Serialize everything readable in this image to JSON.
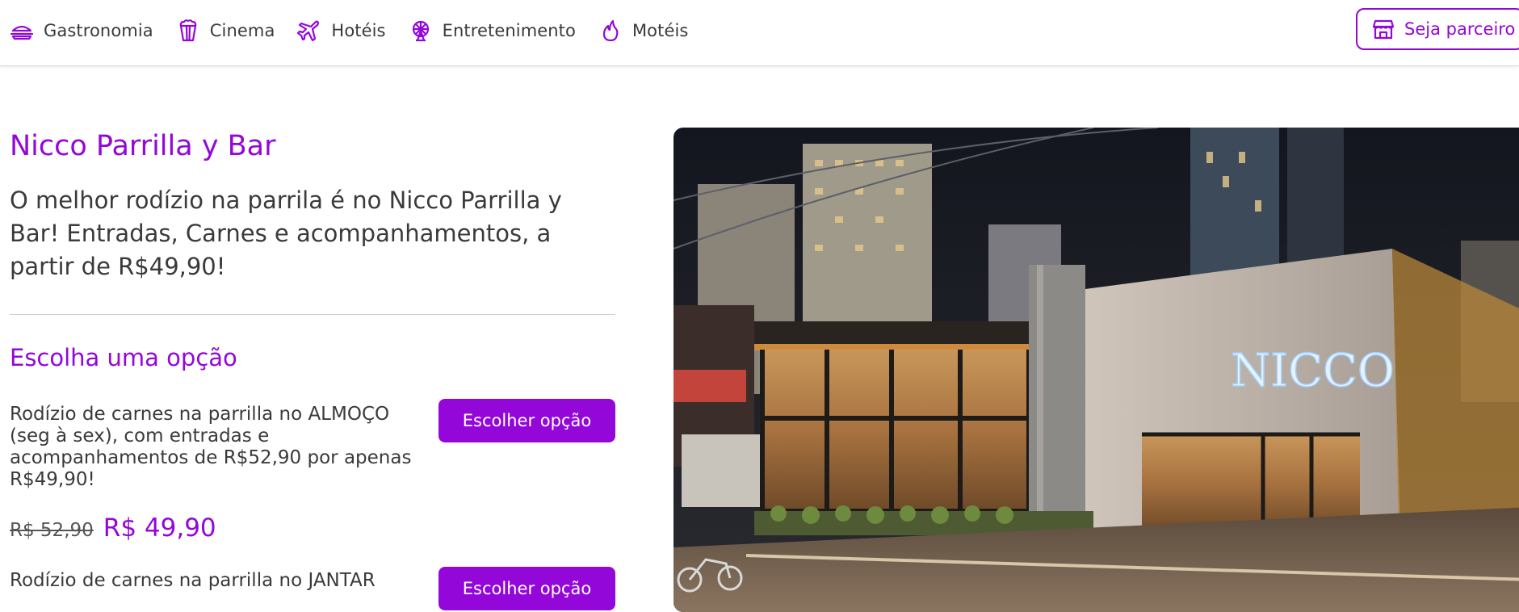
{
  "nav": {
    "items": [
      {
        "label": "Gastronomia",
        "icon": "food-tray-icon"
      },
      {
        "label": "Cinema",
        "icon": "popcorn-icon"
      },
      {
        "label": "Hotéis",
        "icon": "airplane-icon"
      },
      {
        "label": "Entretenimento",
        "icon": "ferris-wheel-icon"
      },
      {
        "label": "Motéis",
        "icon": "flame-icon"
      }
    ],
    "partner_label": "Seja parceiro",
    "partner_icon": "store-icon"
  },
  "colors": {
    "accent": "#9407d9",
    "text": "#3a3a3a"
  },
  "offer": {
    "title": "Nicco Parrilla y Bar",
    "description": "O melhor rodízio na parrila é no Nicco Parrilla y Bar! Entradas, Carnes e acompanhamentos, a partir de R$49,90!",
    "options_title": "Escolha uma opção",
    "options": [
      {
        "text": "Rodízio de carnes na parrilla no ALMOÇO (seg à sex), com entradas e acompanhamentos de R$52,90 por apenas R$49,90!",
        "old_price": "R$ 52,90",
        "new_price": "R$ 49,90",
        "button": "Escolher opção"
      },
      {
        "text": "Rodízio de carnes na parrilla no JANTAR",
        "button": "Escolher opção"
      }
    ]
  },
  "photo": {
    "sign_text": "NICCO"
  }
}
